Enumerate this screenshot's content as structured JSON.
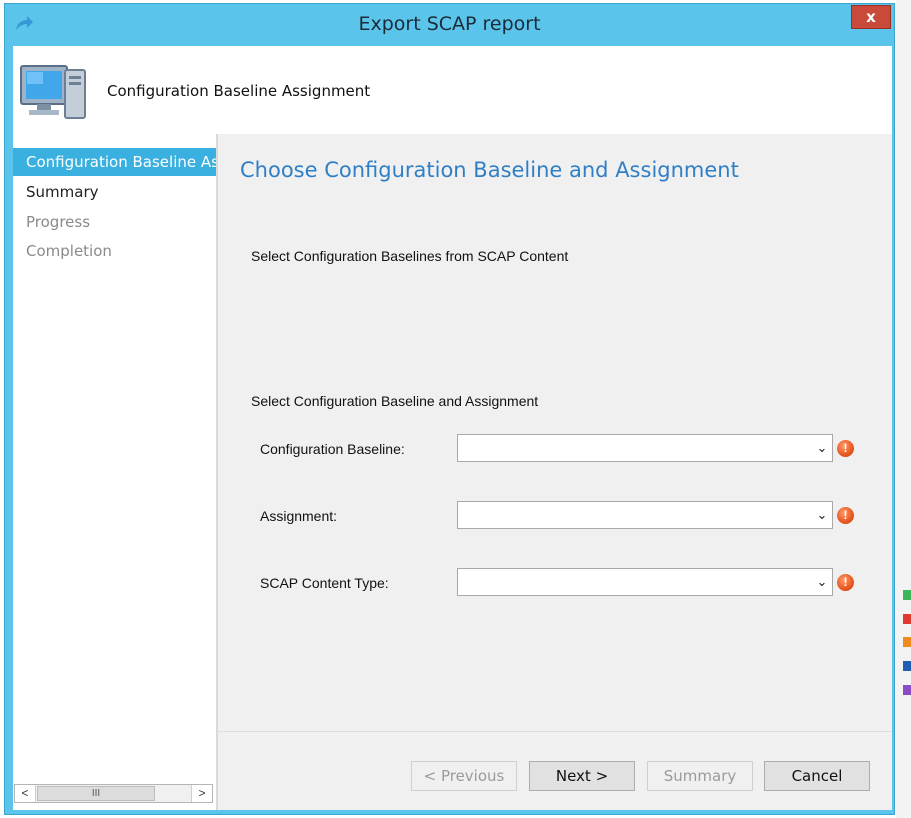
{
  "window": {
    "title": "Export SCAP report",
    "close_glyph": "x"
  },
  "header": {
    "title": "Configuration Baseline Assignment"
  },
  "sidebar": {
    "items": [
      {
        "label": "Configuration Baseline Assignment",
        "state": "active"
      },
      {
        "label": "Summary",
        "state": "normal"
      },
      {
        "label": "Progress",
        "state": "disabled"
      },
      {
        "label": "Completion",
        "state": "disabled"
      }
    ],
    "scrollbar": {
      "left_glyph": "<",
      "right_glyph": ">",
      "thumb_glyph": "III"
    }
  },
  "main": {
    "title": "Choose Configuration Baseline and Assignment",
    "section1_label": "Select Configuration Baselines from SCAP Content",
    "section2_label": "Select Configuration Baseline and Assignment",
    "fields": [
      {
        "label": "Configuration Baseline:",
        "value": ""
      },
      {
        "label": "Assignment:",
        "value": ""
      },
      {
        "label": "SCAP Content Type:",
        "value": ""
      }
    ],
    "error_glyph": "!",
    "dropdown_glyph": "⌄"
  },
  "buttons": {
    "previous": "< Previous",
    "next": "Next >",
    "summary": "Summary",
    "cancel": "Cancel"
  },
  "colors": {
    "titlebar": "#5bc4ea",
    "active_nav": "#3ab0e0",
    "heading": "#2f7fc7",
    "error": "#e8571f",
    "close": "#c94a3b"
  }
}
